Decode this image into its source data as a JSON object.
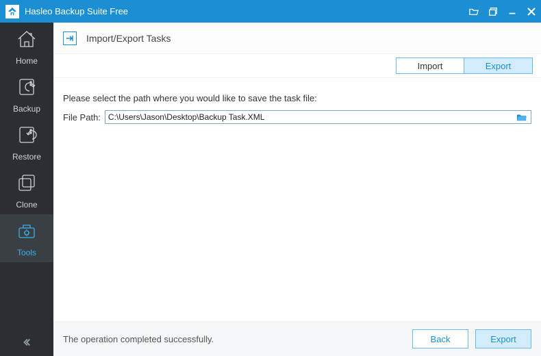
{
  "app": {
    "title": "Hasleo Backup Suite Free"
  },
  "sidebar": {
    "items": [
      {
        "label": "Home"
      },
      {
        "label": "Backup"
      },
      {
        "label": "Restore"
      },
      {
        "label": "Clone"
      },
      {
        "label": "Tools"
      }
    ]
  },
  "page": {
    "title": "Import/Export Tasks"
  },
  "tabs": {
    "import": "Import",
    "export": "Export",
    "active": "export"
  },
  "content": {
    "instruction": "Please select the path where you would like to save the task file:",
    "file_path_label": "File Path:",
    "file_path_value": "C:\\Users\\Jason\\Desktop\\Backup Task.XML"
  },
  "footer": {
    "status": "The operation completed successfully.",
    "back": "Back",
    "export": "Export"
  }
}
